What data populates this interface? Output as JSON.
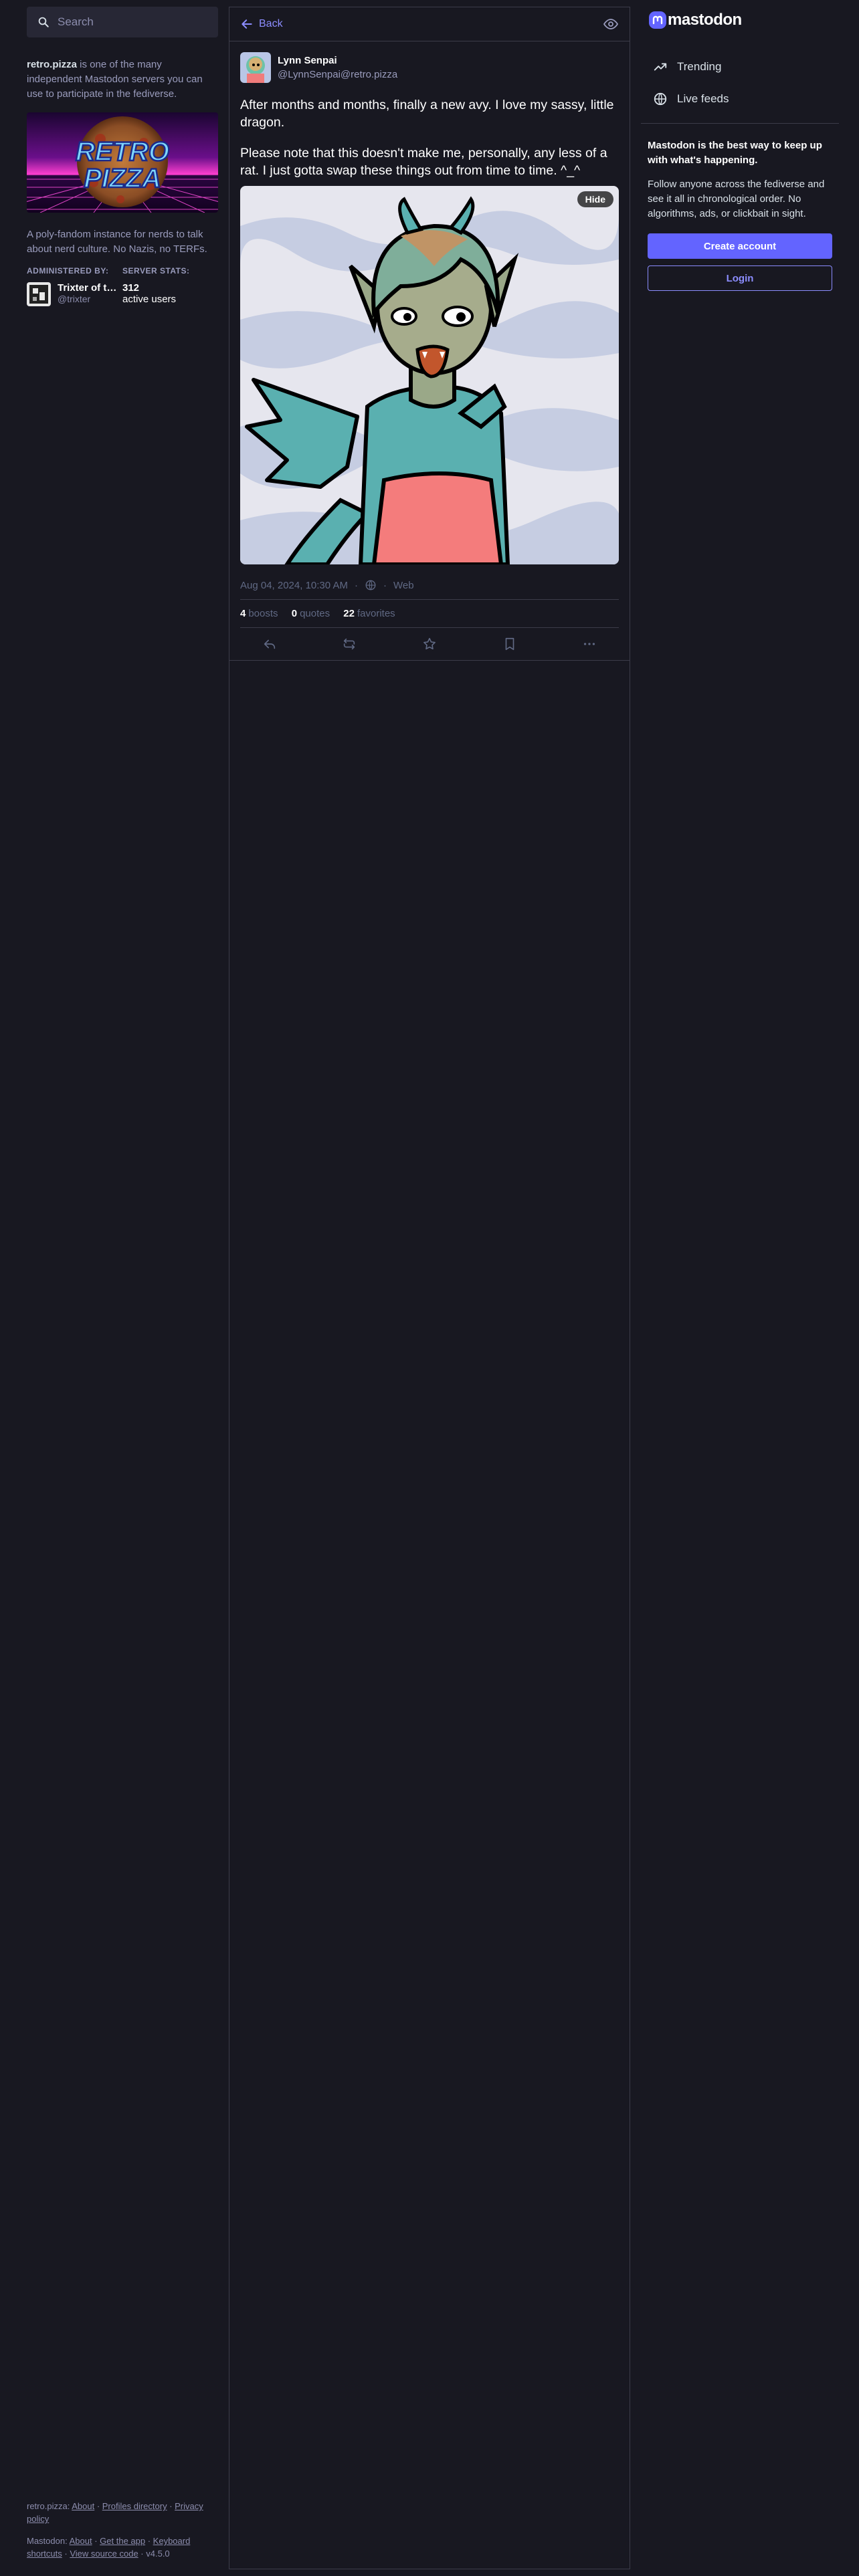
{
  "search": {
    "placeholder": "Search"
  },
  "server": {
    "name": "retro.pizza",
    "intro": " is one of the many independent Mastodon servers you can use to participate in the fediverse.",
    "banner_text": "RETRO PIZZA",
    "description": "A poly-fandom instance for nerds to talk about nerd culture. No Nazis, no TERFs.",
    "admin_heading": "ADMINISTERED BY:",
    "admin_name": "Trixter of the...",
    "admin_handle": "@trixter",
    "stats_heading": "SERVER STATS:",
    "active_users": "312",
    "active_users_label": "active users"
  },
  "column": {
    "back_label": "Back"
  },
  "status": {
    "display_name": "Lynn Senpai",
    "acct": "@LynnSenpai@retro.pizza",
    "paragraphs": [
      "After months and months, finally a new avy.  I love my sassy, little dragon.",
      "Please note that this doesn't make me, personally, any less of a rat. I just gotta swap these things out from time to time.  ^_^"
    ],
    "hide_label": "Hide",
    "timestamp": "Aug 04, 2024, 10:30 AM",
    "application": "Web",
    "boosts_count": "4",
    "boosts_label": "boosts",
    "quotes_count": "0",
    "quotes_label": "quotes",
    "favorites_count": "22",
    "favorites_label": "favorites"
  },
  "sidebar": {
    "logo_text": "mastodon",
    "nav": [
      {
        "label": "Trending"
      },
      {
        "label": "Live feeds"
      }
    ],
    "promo_title": "Mastodon is the best way to keep up with what's happening.",
    "promo_text": "Follow anyone across the fediverse and see it all in chronological order. No algorithms, ads, or clickbait in sight.",
    "create_account": "Create account",
    "login": "Login"
  },
  "footer": {
    "server_label": "retro.pizza:",
    "server_links": [
      "About",
      "Profiles directory",
      "Privacy policy"
    ],
    "mastodon_label": "Mastodon:",
    "mastodon_links": [
      "About",
      "Get the app",
      "Keyboard shortcuts",
      "View source code"
    ],
    "version": "v4.5.0"
  },
  "colors": {
    "accent": "#6364ff",
    "link": "#8c8dff",
    "background": "#181821"
  }
}
